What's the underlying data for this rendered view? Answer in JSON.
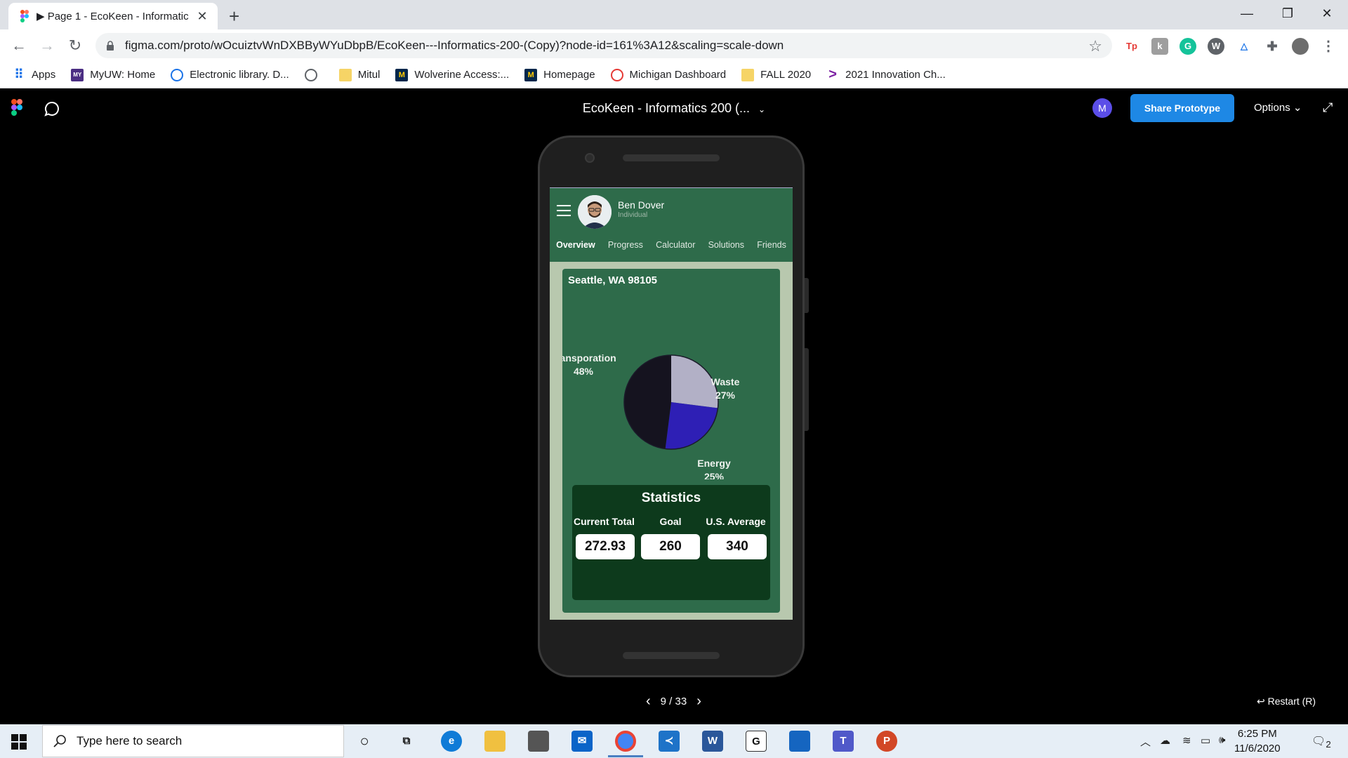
{
  "browser": {
    "tab_title": "▶ Page 1 - EcoKeen - Informatic",
    "tab_close": "✕",
    "new_tab": "+",
    "window_controls": {
      "minimize": "—",
      "restore": "❐",
      "close": "✕"
    },
    "url": "figma.com/proto/wOcuiztvWnDXBByWYuDbpB/EcoKeen---Informatics-200-(Copy)?node-id=161%3A12&scaling=scale-down",
    "bookmarks": [
      {
        "label": "Apps",
        "icon": "apps-grid-icon",
        "color": "#1a73e8"
      },
      {
        "label": "MyUW: Home",
        "icon": "myuw-icon",
        "color": "#4b2e83"
      },
      {
        "label": "Electronic library. D...",
        "icon": "globe-icon",
        "color": "#1a73e8"
      },
      {
        "label": "",
        "icon": "world-icon",
        "color": "#5f6368"
      },
      {
        "label": "Mitul",
        "icon": "folder-icon",
        "color": "#f6d466"
      },
      {
        "label": "Wolverine Access:...",
        "icon": "michigan-m-icon",
        "color": "#00274c"
      },
      {
        "label": "Homepage",
        "icon": "michigan-m-icon",
        "color": "#00274c"
      },
      {
        "label": "Michigan Dashboard",
        "icon": "dashboard-icon",
        "color": "#e53935"
      },
      {
        "label": "FALL 2020",
        "icon": "folder-icon",
        "color": "#f6d466"
      },
      {
        "label": "2021 Innovation Ch...",
        "icon": "chevron-brand-icon",
        "color": "#7b1fa2"
      }
    ]
  },
  "figma": {
    "title": "EcoKeen - Informatics 200 (...",
    "title_chevron": "⌄",
    "avatar_letter": "M",
    "share_label": "Share Prototype",
    "options_label": "Options ⌄",
    "expand": "⤢",
    "pager": {
      "current": "9 / 33",
      "prev": "‹",
      "next": "›"
    },
    "restart_label": "↩  Restart (R)"
  },
  "app": {
    "user_name": "Ben Dover",
    "user_role": "Individual",
    "tabs": [
      "Overview",
      "Progress",
      "Calculator",
      "Solutions",
      "Friends"
    ],
    "active_tab": "Overview",
    "location": "Seattle, WA  98105",
    "stats": {
      "title": "Statistics",
      "current_label": "Current Total",
      "current_value": "272.93",
      "goal_label": "Goal",
      "goal_value": "260",
      "avg_label": "U.S. Average",
      "avg_value": "340"
    }
  },
  "chart_data": {
    "type": "pie",
    "title": "",
    "slices": [
      {
        "label": "Transporation",
        "pct_label": "48%",
        "value": 48,
        "color": "#15131f"
      },
      {
        "label": "Waste",
        "pct_label": "27%",
        "value": 27,
        "color": "#b2b0c6"
      },
      {
        "label": "Energy",
        "pct_label": "25%",
        "value": 25,
        "color": "#2e1fb5"
      }
    ]
  },
  "taskbar": {
    "search_placeholder": "Type here to search",
    "time": "6:25 PM",
    "date": "11/6/2020",
    "notification_count": "2"
  }
}
